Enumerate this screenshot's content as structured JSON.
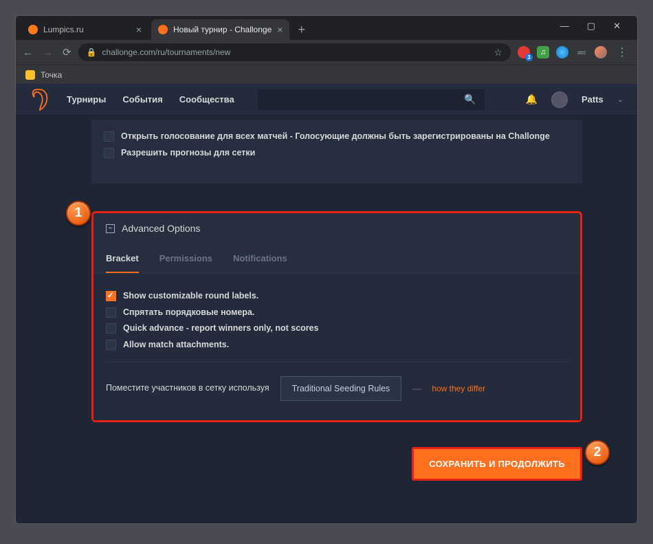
{
  "browser": {
    "tabs": [
      {
        "title": "Lumpics.ru",
        "favicon_color": "#ff7b1a",
        "active": false
      },
      {
        "title": "Новый турнир - Challonge",
        "favicon_color": "#ff6f1d",
        "active": true
      }
    ],
    "url": "challonge.com/ru/tournaments/new",
    "bookmark": "Точка"
  },
  "header": {
    "nav": {
      "tournaments": "Турниры",
      "events": "События",
      "communities": "Сообщества"
    },
    "search_placeholder": "",
    "user": "Patts"
  },
  "upper": {
    "opt1": "Открыть голосование для всех матчей - Голосующие должны быть зарегистрированы на Challonge",
    "opt2": "Разрешить прогнозы для сетки"
  },
  "advanced": {
    "title": "Advanced Options",
    "tabs": {
      "bracket": "Bracket",
      "permissions": "Permissions",
      "notifications": "Notifications"
    },
    "options": {
      "round_labels": "Show customizable round labels.",
      "hide_seeds": "Спрятать порядковые номера.",
      "quick_advance": "Quick advance - report winners only, not scores",
      "attachments": "Allow match attachments."
    },
    "seeding": {
      "label": "Поместите участников в сетку используя",
      "value": "Traditional Seeding Rules",
      "dash": "—",
      "link": "how they differ"
    }
  },
  "submit": "СОХРАНИТЬ И ПРОДОЛЖИТЬ",
  "badges": {
    "one": "1",
    "two": "2"
  }
}
